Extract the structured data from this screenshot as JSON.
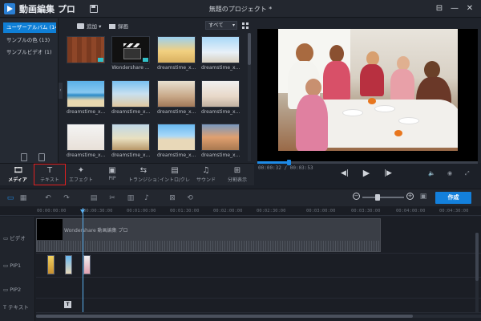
{
  "app": {
    "name": "動画編集 プロ",
    "project_title": "無題のプロジェクト *"
  },
  "window_controls": [
    "⊟",
    "—",
    "✕"
  ],
  "categories": [
    {
      "label": "ユーザーアルバム (14)",
      "active": true
    },
    {
      "label": "サンプルの色 (13)",
      "active": false
    },
    {
      "label": "サンプルビデオ (1)",
      "active": false
    }
  ],
  "media_toolbar": {
    "add_label": "追加 ▾",
    "record_label": "録画",
    "filter_value": "すべて"
  },
  "media_items": [
    {
      "label": "",
      "style": "img-wood",
      "badge": true
    },
    {
      "label": "Wondershare ...",
      "style": "img-clapper",
      "badge": true
    },
    {
      "label": "dreamstime_x...",
      "style": "img-yellow",
      "badge": false
    },
    {
      "label": "dreamstime_x...",
      "style": "img-sky",
      "badge": false
    },
    {
      "label": "dreamstime_x...",
      "style": "img-beach",
      "badge": false
    },
    {
      "label": "dreamstime_x...",
      "style": "img-beach2",
      "badge": false
    },
    {
      "label": "dreamstime_x...",
      "style": "img-family",
      "badge": false
    },
    {
      "label": "dreamstime_x...",
      "style": "img-kid",
      "badge": false
    },
    {
      "label": "dreamstime_x...",
      "style": "img-white",
      "badge": false
    },
    {
      "label": "dreamstime_x...",
      "style": "img-field",
      "badge": false
    },
    {
      "label": "dreamstime_x...",
      "style": "img-beachwide",
      "badge": false
    },
    {
      "label": "dreamstime_x...",
      "style": "img-sunset",
      "badge": false
    }
  ],
  "preview": {
    "timecode": "00:00:32 / 00:03:53",
    "progress": 0.14,
    "buttons": {
      "prev": "◀|",
      "play": "▶",
      "next": "|▶",
      "volume": "🔈",
      "snapshot": "◉",
      "fullscreen": "⤢"
    }
  },
  "tabs": [
    {
      "icon": "🎞",
      "label": "メディア",
      "name": "tab-media",
      "active": true
    },
    {
      "icon": "T",
      "label": "テキスト",
      "name": "tab-text",
      "active": false
    },
    {
      "icon": "✦",
      "label": "エフェクト",
      "name": "tab-effects",
      "active": false
    },
    {
      "icon": "▣",
      "label": "PIP",
      "name": "tab-pip",
      "active": false
    },
    {
      "icon": "⇆",
      "label": "トランジション",
      "name": "tab-transition",
      "active": false
    },
    {
      "icon": "▤",
      "label": "イントロ/クレ...",
      "name": "tab-intro-credit",
      "active": false
    },
    {
      "icon": "♫",
      "label": "サウンド",
      "name": "tab-sound",
      "active": false
    },
    {
      "icon": "⊞",
      "label": "分割表示",
      "name": "tab-split-screen",
      "active": false
    }
  ],
  "timeline": {
    "create_label": "作成",
    "ruler": [
      "00:00:00:00",
      "00:00:30:00",
      "00:01:00:00",
      "00:01:30:00",
      "00:02:00:00",
      "00:02:30:00",
      "00:03:00:00",
      "00:03:30:00",
      "00:04:00:00",
      "00:04:30:00"
    ],
    "tracks": {
      "video": "ビデオ",
      "pip1": "PIP1",
      "pip2": "PIP2",
      "text": "テキスト"
    },
    "video_clip_name": "Wondershare 動画編集 プロ",
    "text_clip_glyph": "T"
  }
}
